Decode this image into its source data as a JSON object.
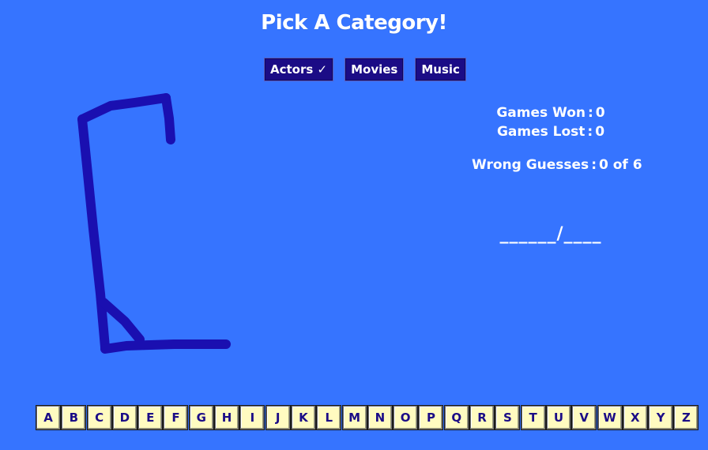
{
  "title": "Pick A Category!",
  "categories": [
    {
      "label": "Actors ✓"
    },
    {
      "label": "Movies"
    },
    {
      "label": "Music"
    }
  ],
  "stats": {
    "games_won_label": "Games Won",
    "games_won_value": "0",
    "games_lost_label": "Games Lost",
    "games_lost_value": "0",
    "wrong_guesses_label": "Wrong Guesses",
    "wrong_guesses_value": "0 of 6"
  },
  "word_display": "______/____",
  "letters": [
    "A",
    "B",
    "C",
    "D",
    "E",
    "F",
    "G",
    "H",
    "I",
    "J",
    "K",
    "L",
    "M",
    "N",
    "O",
    "P",
    "Q",
    "R",
    "S",
    "T",
    "U",
    "V",
    "W",
    "X",
    "Y",
    "Z"
  ],
  "colors": {
    "background": "#3674ff",
    "button": "#1b0c86",
    "gallows": "#1a0fb0",
    "letter_tile": "#fffbc0",
    "text": "#ffffff"
  }
}
